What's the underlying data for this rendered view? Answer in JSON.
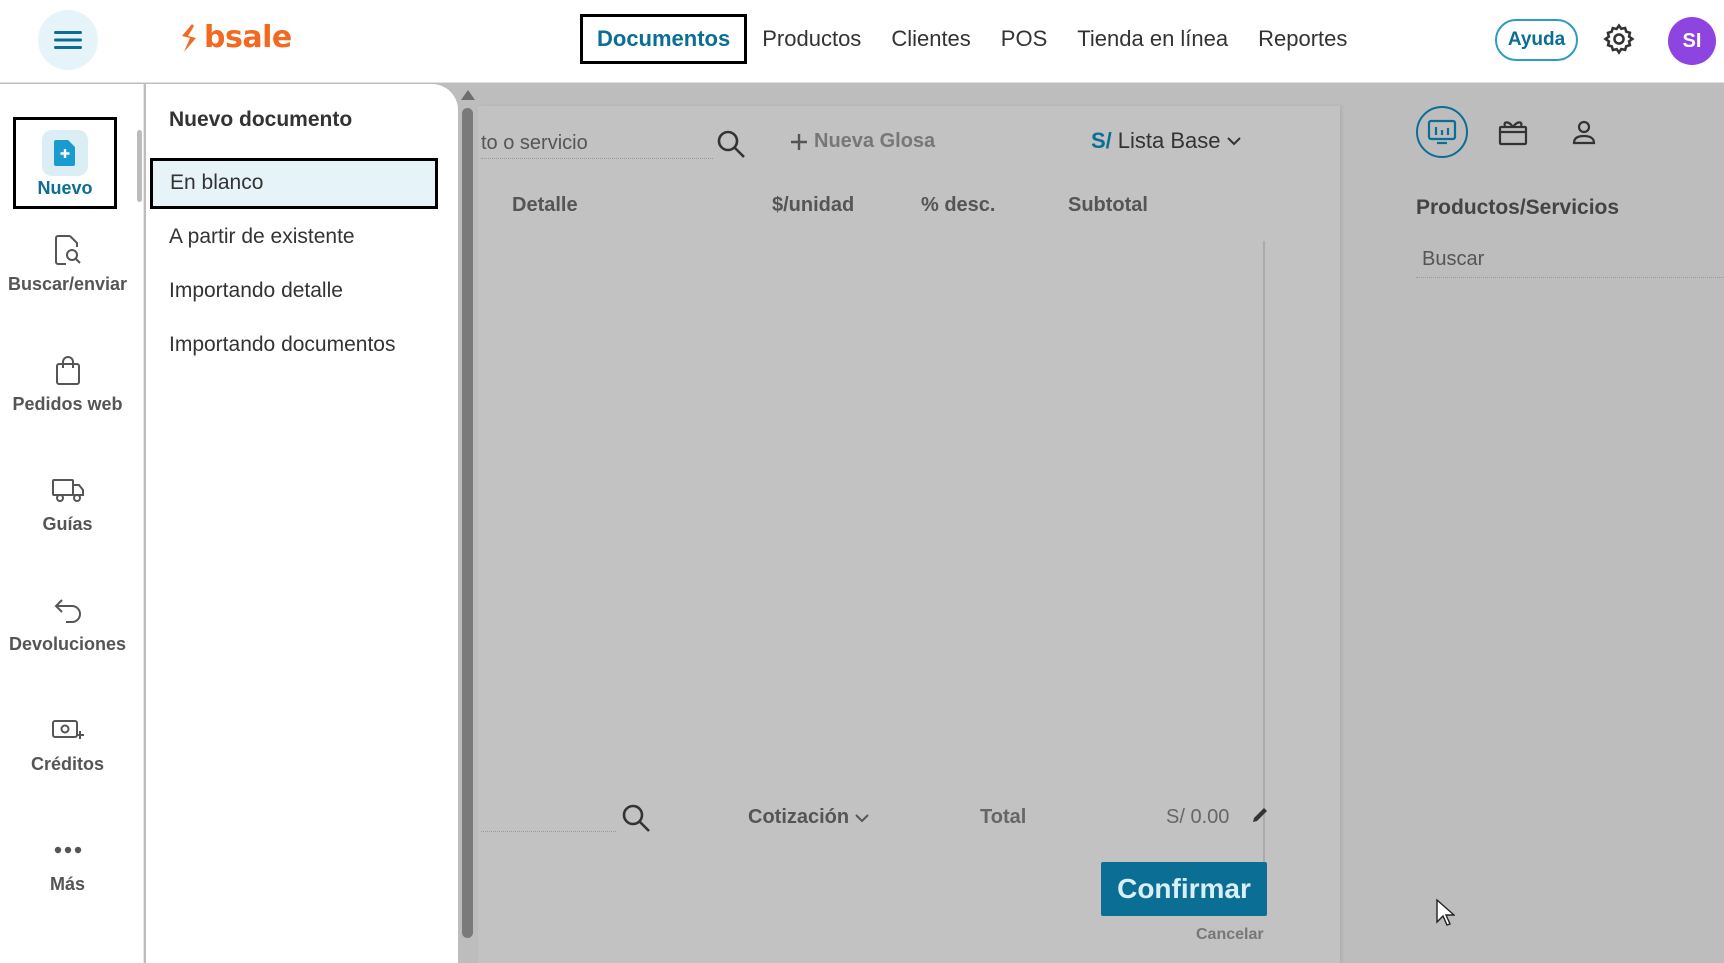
{
  "header": {
    "logo_text": "bsale",
    "nav": [
      {
        "label": "Documentos",
        "active": true
      },
      {
        "label": "Productos"
      },
      {
        "label": "Clientes"
      },
      {
        "label": "POS"
      },
      {
        "label": "Tienda en línea"
      },
      {
        "label": "Reportes"
      }
    ],
    "help_label": "Ayuda",
    "avatar_initials": "SI",
    "icons": {
      "menu": "hamburger-menu-icon",
      "settings": "gear-icon",
      "logo": "bsale-logo-icon"
    }
  },
  "sidebar": {
    "items": [
      {
        "label": "Nuevo",
        "icon": "new-document-icon",
        "active": true
      },
      {
        "label": "Buscar/enviar",
        "icon": "document-search-icon"
      },
      {
        "label": "Pedidos web",
        "icon": "shopping-bag-icon"
      },
      {
        "label": "Guías",
        "icon": "truck-icon"
      },
      {
        "label": "Devoluciones",
        "icon": "return-arrow-icon"
      },
      {
        "label": "Créditos",
        "icon": "money-plus-icon"
      },
      {
        "label": "Más",
        "icon": "more-dots-icon"
      }
    ]
  },
  "dropdown": {
    "title": "Nuevo documento",
    "items": [
      {
        "label": "En blanco",
        "selected": true
      },
      {
        "label": "A partir de existente"
      },
      {
        "label": "Importando detalle"
      },
      {
        "label": "Importando documentos"
      }
    ]
  },
  "document": {
    "product_placeholder": "to o servicio",
    "new_glosa_label": "Nueva Glosa",
    "price_list": {
      "currency": "S/",
      "label": "Lista Base"
    },
    "columns": [
      "Detalle",
      "$/unidad",
      "% desc.",
      "Subtotal"
    ],
    "doc_type": "Cotización",
    "total_label": "Total",
    "total_value": "S/ 0.00",
    "confirm_label": "Confirmar",
    "cancel_label": "Cancelar"
  },
  "right_panel": {
    "tabs": [
      {
        "icon": "products-grid-icon",
        "active": true
      },
      {
        "icon": "gift-box-icon"
      },
      {
        "icon": "person-icon"
      }
    ],
    "title": "Productos/Servicios",
    "search_placeholder": "Buscar"
  },
  "colors": {
    "primary": "#0b6e94",
    "brand_orange": "#f26a21",
    "avatar": "#8e44e0",
    "overlay_gray": "#bdbdbd"
  }
}
